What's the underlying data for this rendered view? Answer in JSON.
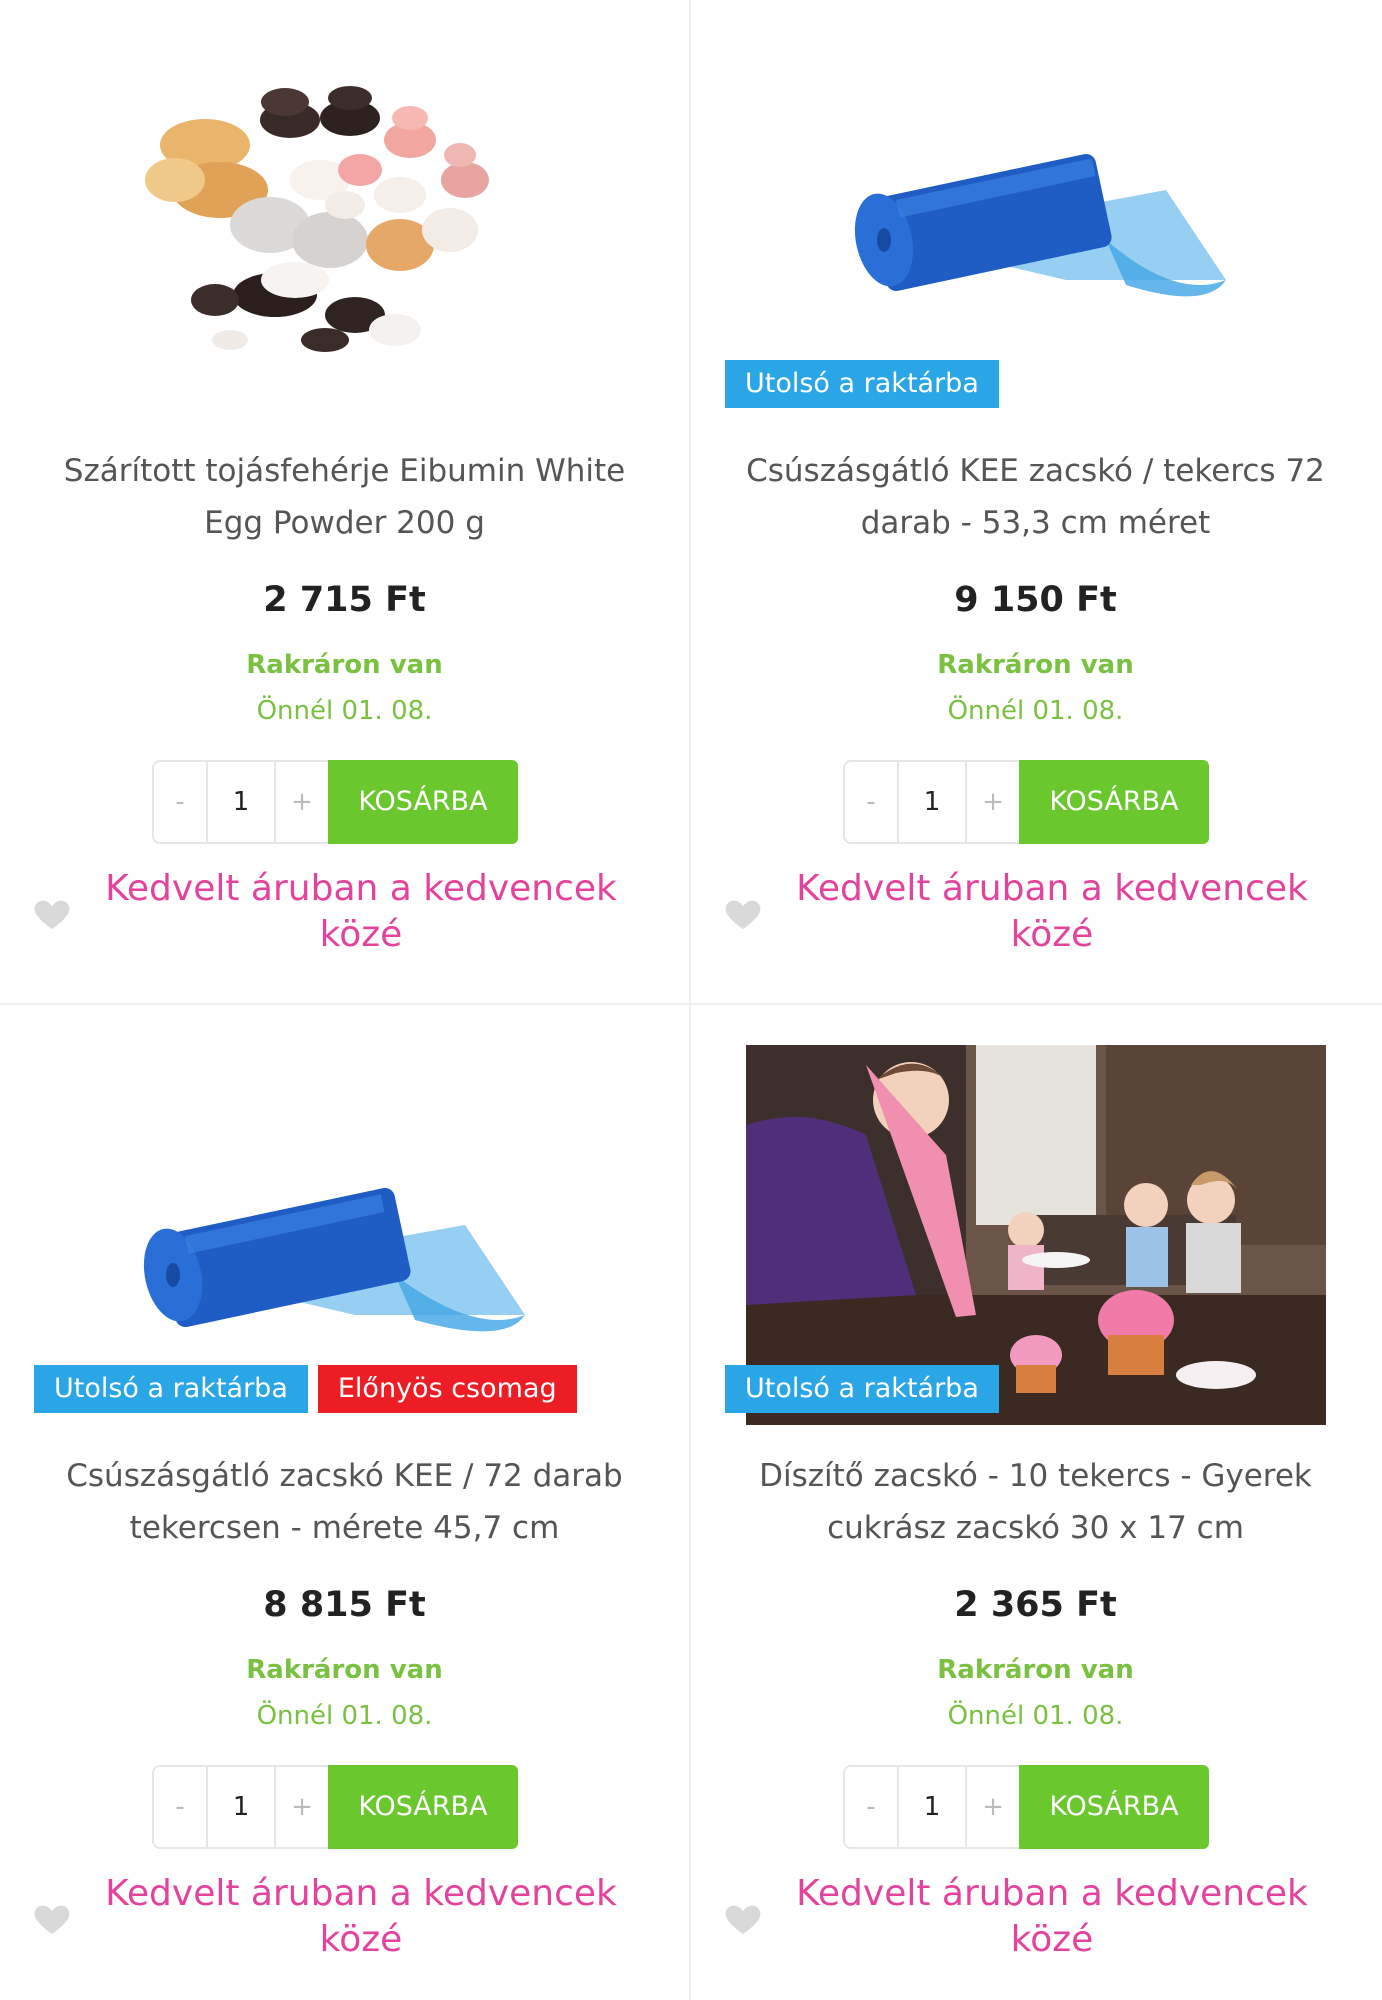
{
  "products": [
    {
      "title": "Szárított tojásfehérje Eibumin White Egg Powder 200 g",
      "price": "2 715 Ft",
      "stock": "Rakráron van",
      "delivery": "Önnél 01. 08.",
      "badges": [],
      "image": "meringue-cookies-photo",
      "quantity": "1",
      "minus": "-",
      "plus": "+",
      "cart_label": "KOSÁRBA",
      "favorite_label": "Kedvelt áruban a kedvencek közé"
    },
    {
      "title": "Csúszásgátló KEE zacskó / tekercs 72 darab - 53,3 cm méret",
      "price": "9 150 Ft",
      "stock": "Rakráron van",
      "delivery": "Önnél 01. 08.",
      "badges": [
        "Utolsó a raktárba"
      ],
      "image": "blue-piping-bag-roll-photo",
      "quantity": "1",
      "minus": "-",
      "plus": "+",
      "cart_label": "KOSÁRBA",
      "favorite_label": "Kedvelt áruban a kedvencek közé"
    },
    {
      "title": "Csúszásgátló zacskó KEE / 72 darab tekercsen - mérete 45,7 cm",
      "price": "8 815 Ft",
      "stock": "Rakráron van",
      "delivery": "Önnél 01. 08.",
      "badges": [
        "Utolsó a raktárba",
        "Előnyös csomag"
      ],
      "image": "blue-piping-bag-roll-photo",
      "quantity": "1",
      "minus": "-",
      "plus": "+",
      "cart_label": "KOSÁRBA",
      "favorite_label": "Kedvelt áruban a kedvencek közé"
    },
    {
      "title": "Díszítő zacskó - 10 tekercs - Gyerek cukrász zacskó 30 x 17 cm",
      "price": "2 365 Ft",
      "stock": "Rakráron van",
      "delivery": "Önnél 01. 08.",
      "badges": [
        "Utolsó a raktárba"
      ],
      "image": "kids-decorating-cupcakes-photo",
      "quantity": "1",
      "minus": "-",
      "plus": "+",
      "cart_label": "KOSÁRBA",
      "favorite_label": "Kedvelt áruban a kedvencek közé"
    }
  ],
  "colors": {
    "accent_green": "#6ac72e",
    "stock_green": "#7ac142",
    "favorite_pink": "#e4439d",
    "badge_blue": "#2aa6e6",
    "badge_red": "#ec1d24"
  }
}
